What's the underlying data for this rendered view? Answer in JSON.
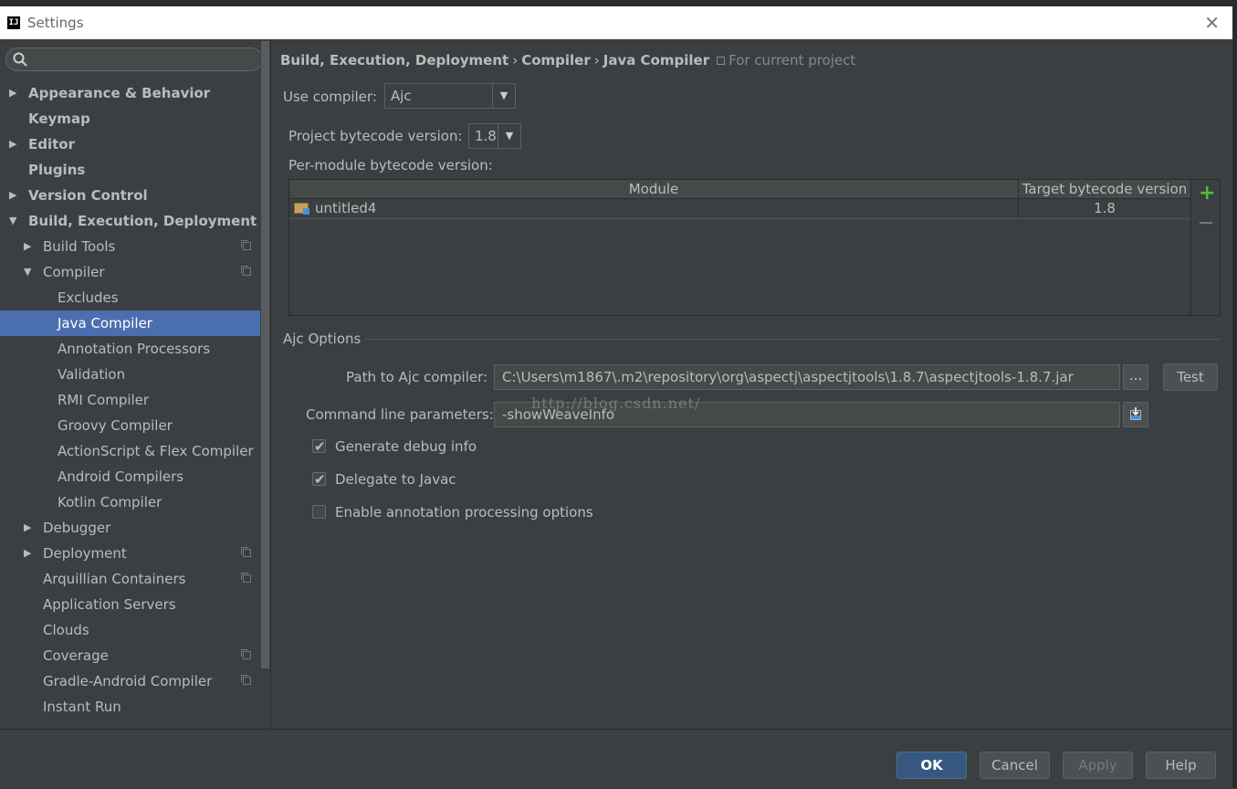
{
  "window": {
    "title": "Settings",
    "logo": "IJ"
  },
  "search": {
    "placeholder": ""
  },
  "sidebar": {
    "items": [
      {
        "label": "Appearance & Behavior",
        "arrow": "▶"
      },
      {
        "label": "Keymap",
        "arrow": ""
      },
      {
        "label": "Editor",
        "arrow": "▶"
      },
      {
        "label": "Plugins",
        "arrow": ""
      },
      {
        "label": "Version Control",
        "arrow": "▶"
      },
      {
        "label": "Build, Execution, Deployment",
        "arrow": "▼"
      },
      {
        "label": "Build Tools",
        "arrow": "▶"
      },
      {
        "label": "Compiler",
        "arrow": "▼"
      },
      {
        "label": "Excludes",
        "arrow": ""
      },
      {
        "label": "Java Compiler",
        "arrow": ""
      },
      {
        "label": "Annotation Processors",
        "arrow": ""
      },
      {
        "label": "Validation",
        "arrow": ""
      },
      {
        "label": "RMI Compiler",
        "arrow": ""
      },
      {
        "label": "Groovy Compiler",
        "arrow": ""
      },
      {
        "label": "ActionScript & Flex Compiler",
        "arrow": ""
      },
      {
        "label": "Android Compilers",
        "arrow": ""
      },
      {
        "label": "Kotlin Compiler",
        "arrow": ""
      },
      {
        "label": "Debugger",
        "arrow": "▶"
      },
      {
        "label": "Deployment",
        "arrow": "▶"
      },
      {
        "label": "Arquillian Containers",
        "arrow": ""
      },
      {
        "label": "Application Servers",
        "arrow": ""
      },
      {
        "label": "Clouds",
        "arrow": ""
      },
      {
        "label": "Coverage",
        "arrow": ""
      },
      {
        "label": "Gradle-Android Compiler",
        "arrow": ""
      },
      {
        "label": "Instant Run",
        "arrow": ""
      }
    ],
    "selected_index": 9
  },
  "breadcrumb": {
    "part1": "Build, Execution, Deployment",
    "sep": "›",
    "part2": "Compiler",
    "part3": "Java Compiler",
    "scope": "For current project"
  },
  "compiler": {
    "use_compiler_label": "Use compiler:",
    "use_compiler_value": "Ajc",
    "bytecode_label": "Project bytecode version:",
    "bytecode_value": "1.8",
    "per_module_label": "Per-module bytecode version:"
  },
  "module_table": {
    "headers": [
      "Module",
      "Target bytecode version"
    ],
    "rows": [
      {
        "module": "untitled4",
        "version": "1.8"
      }
    ]
  },
  "ajc": {
    "section_title": "Ajc Options",
    "path_label": "Path to Ajc compiler:",
    "path_value": "C:\\Users\\m1867\\.m2\\repository\\org\\aspectj\\aspectjtools\\1.8.7\\aspectjtools-1.8.7.jar",
    "browse_label": "...",
    "test_label": "Test",
    "cmd_label": "Command line parameters:",
    "cmd_value": "-showWeaveInfo",
    "checkboxes": [
      {
        "label": "Generate debug info",
        "checked": true
      },
      {
        "label": "Delegate to Javac",
        "checked": true
      },
      {
        "label": "Enable annotation processing options",
        "checked": false
      }
    ]
  },
  "watermark": "http://blog.csdn.net/",
  "footer": {
    "ok": "OK",
    "cancel": "Cancel",
    "apply": "Apply",
    "help": "Help"
  },
  "colors": {
    "selection": "#4b6eaf",
    "background": "#3c3f41",
    "add": "#4fbf3a"
  }
}
